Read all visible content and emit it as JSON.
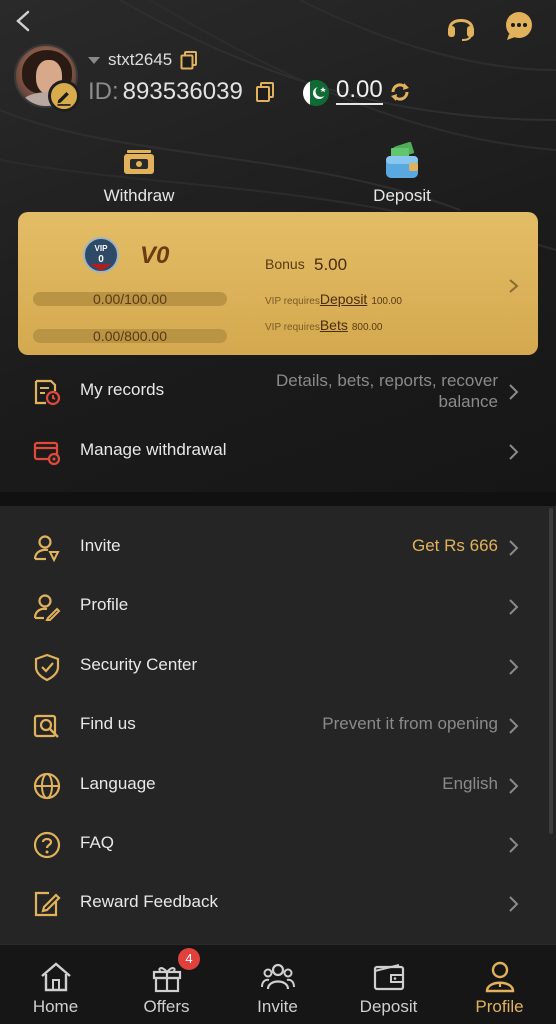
{
  "colors": {
    "accent": "#e1b25b",
    "card": "#d4a94f",
    "badge": "#e0413c",
    "background": "#222222"
  },
  "header": {
    "username": "stxt2645",
    "id_label": "ID:",
    "id_value": "893536039",
    "balance": "0.00",
    "icons": [
      "back-icon",
      "headset-icon",
      "chat-icon",
      "copy-icon",
      "pakistan-flag-icon",
      "refresh-icon",
      "edit-icon"
    ]
  },
  "actions": {
    "withdraw": "Withdraw",
    "deposit": "Deposit"
  },
  "vip": {
    "level": "V0",
    "badge_text": "VIP",
    "badge_number": "0",
    "progress_1": "0.00/100.00",
    "progress_1_fraction": 0,
    "progress_2": "0.00/800.00",
    "progress_2_fraction": 0,
    "bonus_label": "Bonus",
    "bonus_value": "5.00",
    "req_prefix": "VIP requires",
    "req_deposit_link": "Deposit",
    "req_deposit_amount": "100.00",
    "req_bets_link": "Bets",
    "req_bets_amount": "800.00"
  },
  "menu_top": [
    {
      "label": "My records",
      "value": "Details, bets, reports, recover balance",
      "icon": "records-icon"
    },
    {
      "label": "Manage withdrawal",
      "value": "",
      "icon": "withdrawal-card-icon"
    }
  ],
  "menu_bottom": [
    {
      "label": "Invite",
      "value": "Get Rs 666",
      "icon": "invite-user-icon"
    },
    {
      "label": "Profile",
      "value": "",
      "icon": "profile-edit-icon"
    },
    {
      "label": "Security Center",
      "value": "",
      "icon": "shield-check-icon"
    },
    {
      "label": "Find us",
      "value": "Prevent it from opening",
      "icon": "find-us-icon"
    },
    {
      "label": "Language",
      "value": "English",
      "icon": "globe-icon"
    },
    {
      "label": "FAQ",
      "value": "",
      "icon": "question-icon"
    },
    {
      "label": "Reward Feedback",
      "value": "",
      "icon": "feedback-edit-icon"
    }
  ],
  "tabs": [
    {
      "label": "Home",
      "icon": "home-icon"
    },
    {
      "label": "Offers",
      "icon": "gift-icon",
      "badge": "4"
    },
    {
      "label": "Invite",
      "icon": "people-icon"
    },
    {
      "label": "Deposit",
      "icon": "wallet-icon"
    },
    {
      "label": "Profile",
      "icon": "person-icon",
      "active": true
    }
  ]
}
